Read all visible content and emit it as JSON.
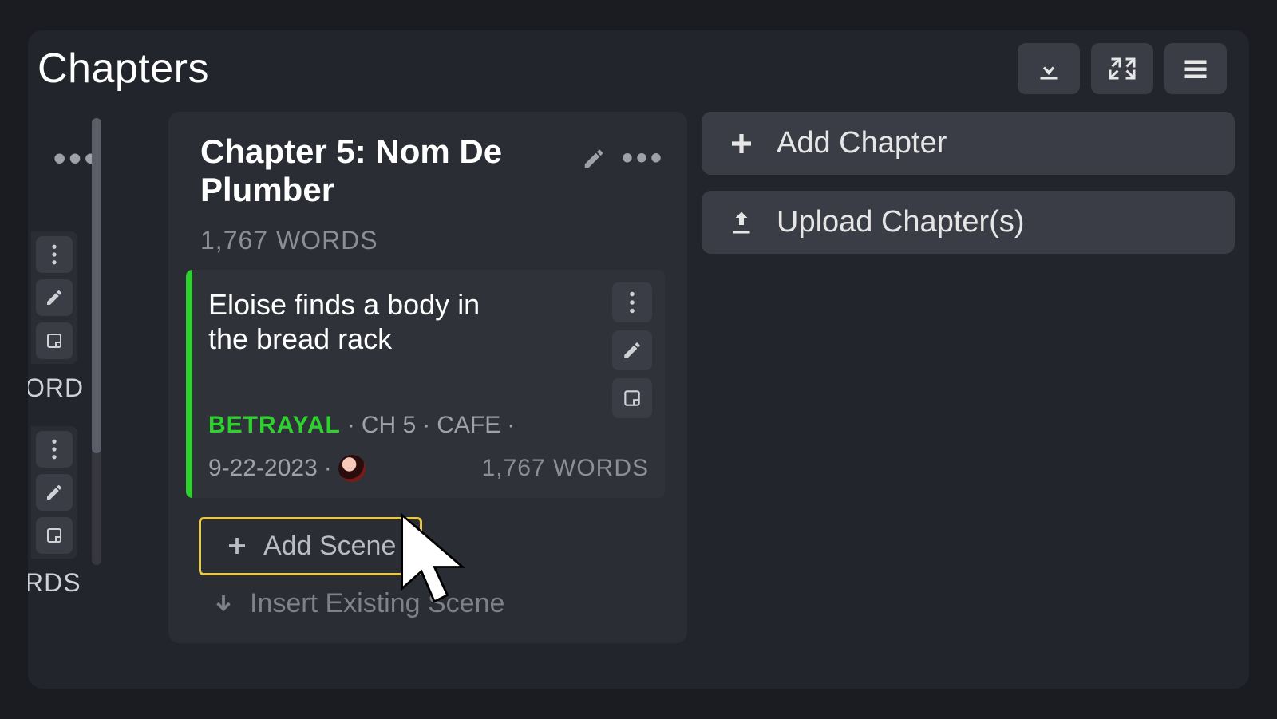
{
  "header": {
    "title": "Chapters"
  },
  "left_sliver": {
    "word_fragment_1": "ORD",
    "word_fragment_2": "RDS"
  },
  "chapter": {
    "title": "Chapter 5: Nom De Plumber",
    "word_count": "1,767 WORDS",
    "scene": {
      "title": "Eloise finds a body in the bread rack",
      "tag": "BETRAYAL",
      "chapter_ref": "CH 5",
      "location": "CAFE",
      "date": "9-22-2023",
      "word_count": "1,767 WORDS"
    },
    "add_scene_label": "Add Scene",
    "insert_existing_label": "Insert Existing Scene"
  },
  "right": {
    "add_chapter_label": "Add Chapter",
    "upload_chapter_label": "Upload Chapter(s)"
  }
}
